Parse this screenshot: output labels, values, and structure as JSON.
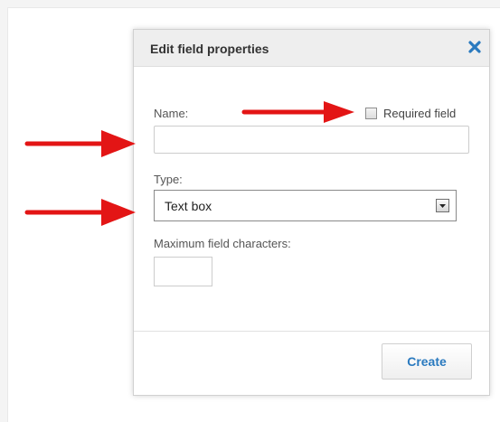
{
  "dialog": {
    "title": "Edit field properties",
    "close_icon": "close-icon",
    "name_label": "Name:",
    "required_label": "Required field",
    "type_label": "Type:",
    "type_value": "Text box",
    "max_label": "Maximum field characters:",
    "create_label": "Create"
  },
  "colors": {
    "accent": "#2a7abf",
    "arrow": "#e31515"
  }
}
